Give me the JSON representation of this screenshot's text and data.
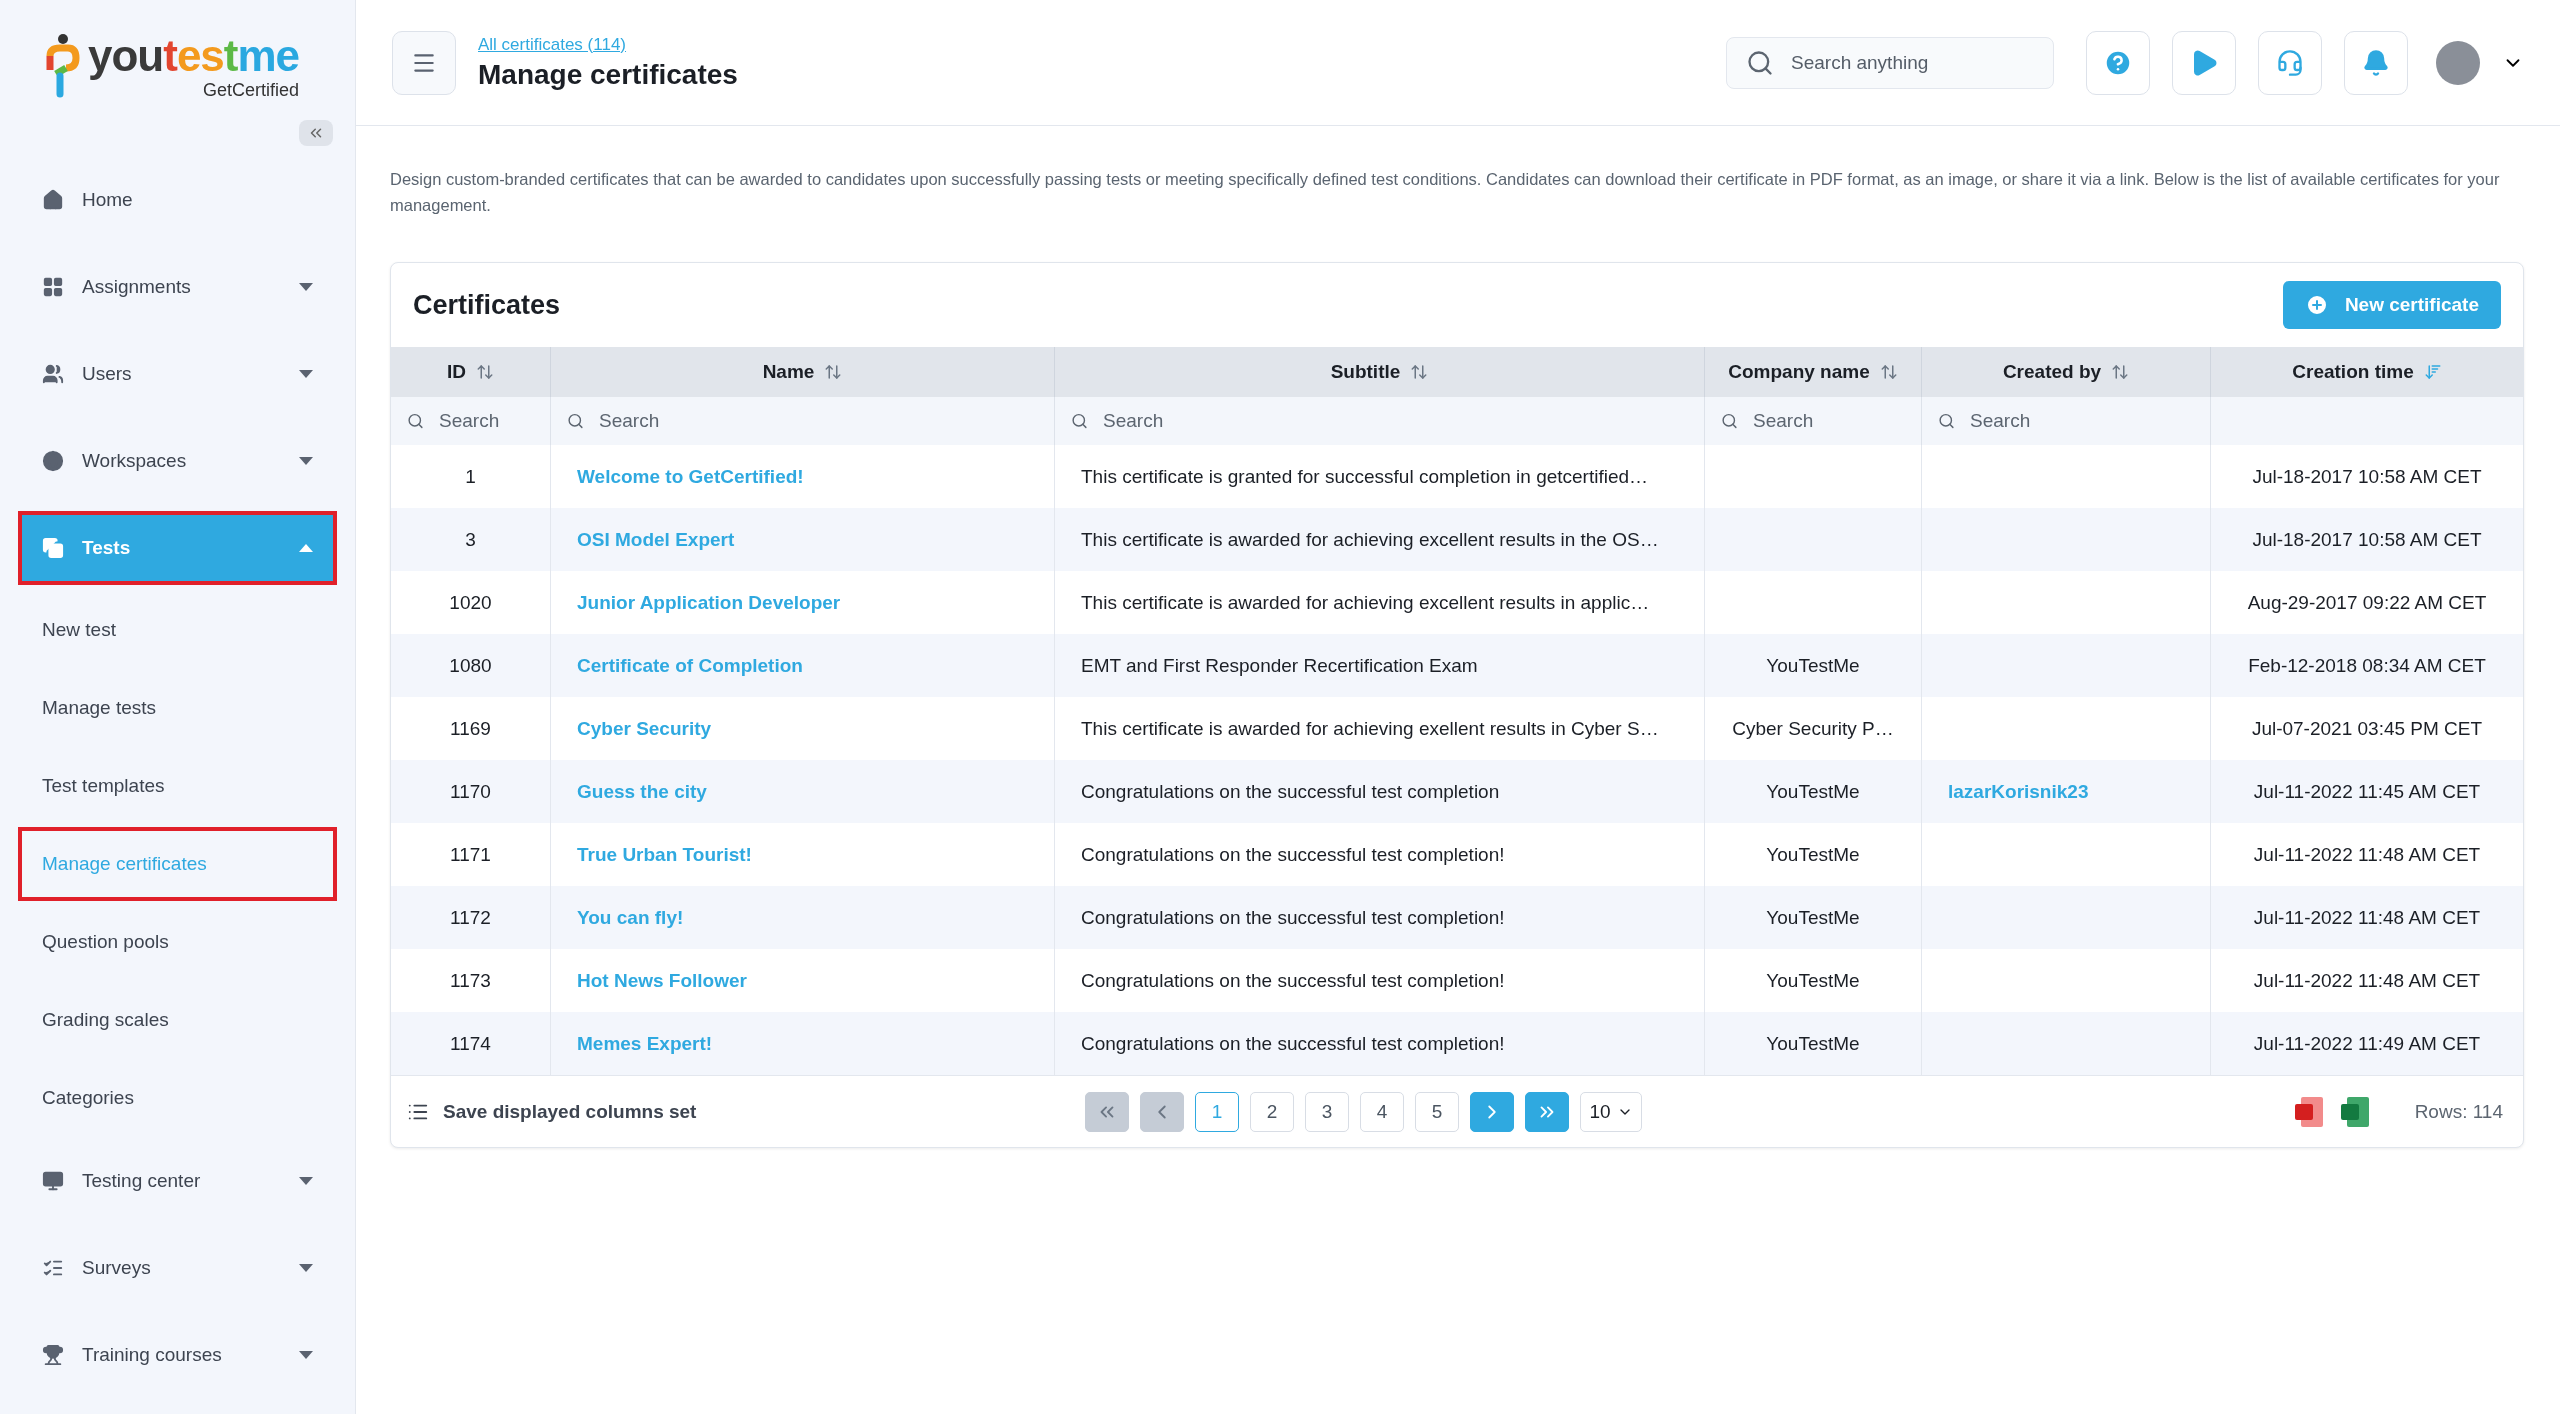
{
  "logo": {
    "parts": [
      {
        "text": "you",
        "color": "#3a3a3a"
      },
      {
        "text": "t",
        "color": "#e2452f"
      },
      {
        "text": "es",
        "color": "#f39a1e"
      },
      {
        "text": "t",
        "color": "#5cb946"
      },
      {
        "text": "me",
        "color": "#2aa8e0"
      }
    ],
    "subtitle": "GetCertified"
  },
  "sidebar": {
    "items": [
      {
        "label": "Home",
        "selected": false
      },
      {
        "label": "Assignments",
        "expanded": false,
        "selected": false
      },
      {
        "label": "Users",
        "expanded": false,
        "selected": false
      },
      {
        "label": "Workspaces",
        "expanded": false,
        "selected": false
      },
      {
        "label": "Tests",
        "expanded": true,
        "selected": true,
        "children": [
          {
            "label": "New test",
            "selected": false
          },
          {
            "label": "Manage tests",
            "selected": false
          },
          {
            "label": "Test templates",
            "selected": false
          },
          {
            "label": "Manage certificates",
            "selected": true
          },
          {
            "label": "Question pools",
            "selected": false
          },
          {
            "label": "Grading scales",
            "selected": false
          },
          {
            "label": "Categories",
            "selected": false
          }
        ]
      },
      {
        "label": "Testing center",
        "expanded": false,
        "selected": false
      },
      {
        "label": "Surveys",
        "expanded": false,
        "selected": false
      },
      {
        "label": "Training courses",
        "expanded": false,
        "selected": false
      }
    ]
  },
  "header": {
    "breadcrumb": "All certificates (114)",
    "title": "Manage certificates",
    "search": {
      "placeholder": "Search anything"
    }
  },
  "description": "Design custom-branded certificates that can be awarded to candidates upon successfully passing tests or meeting specifically defined test conditions. Candidates can download their certificate in PDF format, as an image, or share it via a link. Below is the list of available certificates for your management.",
  "card": {
    "title": "Certificates",
    "new_button": "New certificate"
  },
  "table": {
    "columns": [
      {
        "label": "ID",
        "sorted": false,
        "placeholder": "Search"
      },
      {
        "label": "Name",
        "sorted": false,
        "placeholder": "Search"
      },
      {
        "label": "Subtitle",
        "sorted": false,
        "placeholder": "Search"
      },
      {
        "label": "Company name",
        "sorted": false,
        "placeholder": "Search"
      },
      {
        "label": "Created by",
        "sorted": false,
        "placeholder": "Search"
      },
      {
        "label": "Creation time",
        "sorted": true
      }
    ],
    "rows": [
      [
        "1",
        "Welcome to GetCertified!",
        "This certificate is granted for successful completion in getcertified…",
        "",
        "",
        "Jul-18-2017 10:58 AM CET"
      ],
      [
        "3",
        "OSI Model Expert",
        "This certificate is awarded for achieving excellent results in the OS…",
        "",
        "",
        "Jul-18-2017 10:58 AM CET"
      ],
      [
        "1020",
        "Junior Application Developer",
        "This certificate is awarded for achieving excellent results in applic…",
        "",
        "",
        "Aug-29-2017 09:22 AM CET"
      ],
      [
        "1080",
        "Certificate of Completion",
        "EMT and First Responder Recertification Exam",
        "YouTestMe",
        "",
        "Feb-12-2018 08:34 AM CET"
      ],
      [
        "1169",
        "Cyber Security",
        "This certificate is awarded for achieving exellent results in Cyber S…",
        "Cyber Security P…",
        "",
        "Jul-07-2021 03:45 PM CET"
      ],
      [
        "1170",
        "Guess the city",
        "Congratulations on the successful test completion",
        "YouTestMe",
        "lazarKorisnik23",
        "Jul-11-2022 11:45 AM CET"
      ],
      [
        "1171",
        "True Urban Tourist!",
        "Congratulations on the successful test completion!",
        "YouTestMe",
        "",
        "Jul-11-2022 11:48 AM CET"
      ],
      [
        "1172",
        "You can fly!",
        "Congratulations on the successful test completion!",
        "YouTestMe",
        "",
        "Jul-11-2022 11:48 AM CET"
      ],
      [
        "1173",
        "Hot News Follower",
        "Congratulations on the successful test completion!",
        "YouTestMe",
        "",
        "Jul-11-2022 11:48 AM CET"
      ],
      [
        "1174",
        "Memes Expert!",
        "Congratulations on the successful test completion!",
        "YouTestMe",
        "",
        "Jul-11-2022 11:49 AM CET"
      ]
    ]
  },
  "footer": {
    "save_columns": "Save displayed columns set",
    "pages": [
      {
        "label": "1",
        "selected": true
      },
      {
        "label": "2",
        "selected": false
      },
      {
        "label": "3",
        "selected": false
      },
      {
        "label": "4",
        "selected": false
      },
      {
        "label": "5",
        "selected": false
      }
    ],
    "first_disabled": true,
    "prev_disabled": true,
    "next_disabled": false,
    "last_disabled": false,
    "page_size": "10",
    "rows_count": "Rows: 114"
  }
}
